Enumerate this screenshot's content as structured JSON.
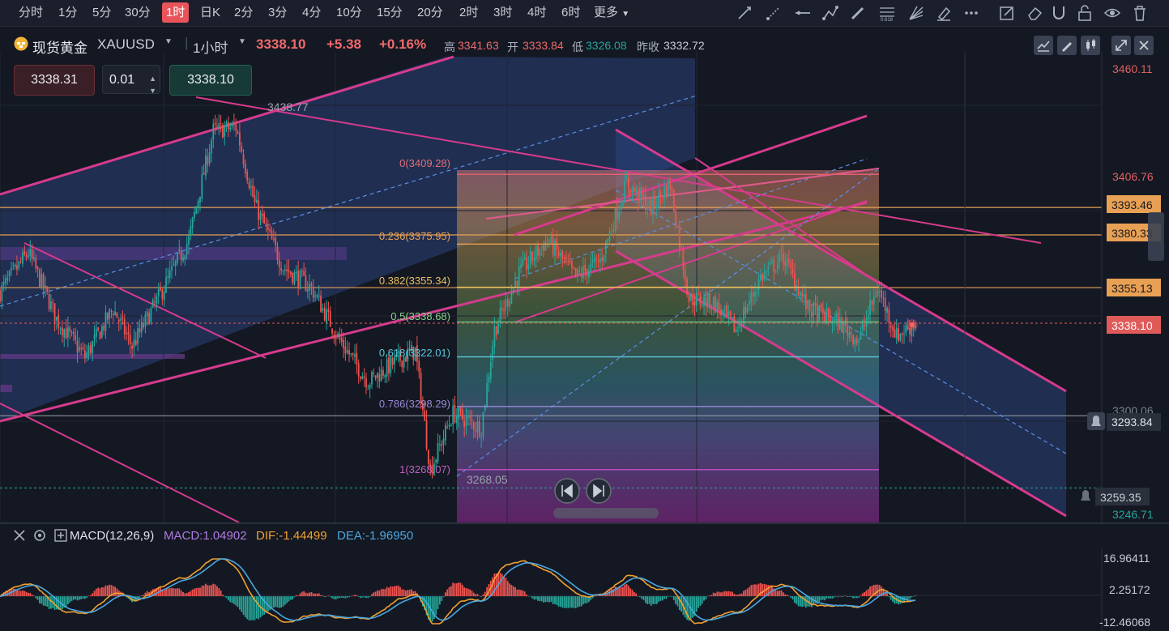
{
  "toolbar": {
    "timeframes": [
      "分时",
      "1分",
      "5分",
      "30分",
      "1时",
      "日K",
      "2分",
      "3分",
      "4分",
      "10分",
      "15分",
      "20分",
      "2时",
      "3时",
      "4时",
      "6时",
      "更多"
    ],
    "active_timeframe": "1时",
    "tools": [
      "trend-line-icon",
      "ray-line-icon",
      "horizontal-line-icon",
      "polyline-icon",
      "brush-icon",
      "fibonacci-icon",
      "fan-icon",
      "highlighter-icon",
      "more-dots-icon",
      "edit-note-icon",
      "eraser-icon",
      "magnet-icon",
      "lock-icon",
      "eye-icon",
      "trash-icon"
    ]
  },
  "symbol": {
    "name": "现货黄金",
    "code": "XAUUSD",
    "interval": "1小时",
    "price": "3338.10",
    "change": "+5.38",
    "change_pct": "+0.16%",
    "high_label": "高",
    "high": "3341.63",
    "open_label": "开",
    "open": "3333.84",
    "low_label": "低",
    "low": "3326.08",
    "prev_label": "昨收",
    "prev": "3332.72"
  },
  "order": {
    "sell_price": "3338.31",
    "lot": "0.01",
    "buy_price": "3338.10"
  },
  "colors": {
    "up": "#26a69a",
    "down": "#ef5350",
    "channel": "#d63b8d",
    "level": "#e8a055",
    "price_tag": "#e06060"
  },
  "price_axis": {
    "top": "3460.11",
    "l1": "3406.76",
    "l2": "3393.46",
    "l3": "3380.33",
    "l4": "3355.13",
    "current": "3338.10",
    "l5": "3300.06",
    "l6": "3293.84",
    "l7": "3259.35",
    "bottom": "3246.71"
  },
  "fib": {
    "f0": "0(3409.28)",
    "f236": "0.236(3375.95)",
    "f382": "0.382(3355.34)",
    "f5": "0.5(3338.68)",
    "f618": "0.618(3322.01)",
    "f786": "0.786(3298.29)",
    "f1": "1(3268.07)"
  },
  "annotations": {
    "high_mark": "3438.77",
    "low_mark": "3268.05"
  },
  "macd": {
    "label": "MACD(12,26,9)",
    "macd_value": "MACD:1.04902",
    "dif_value": "DIF:-1.44499",
    "dea_value": "DEA:-1.96950",
    "axis_top": "16.96411",
    "axis_mid": "2.25172",
    "axis_bottom": "-12.46068"
  },
  "chart_data": {
    "type": "candlestick",
    "title": "现货黄金 XAUUSD 1小时",
    "ylim": [
      3246.71,
      3460.11
    ],
    "keypoints": [
      {
        "i": 0,
        "price": 3353
      },
      {
        "i": 15,
        "price": 3372
      },
      {
        "i": 30,
        "price": 3340
      },
      {
        "i": 45,
        "price": 3322
      },
      {
        "i": 60,
        "price": 3345
      },
      {
        "i": 70,
        "price": 3327
      },
      {
        "i": 85,
        "price": 3352
      },
      {
        "i": 100,
        "price": 3378
      },
      {
        "i": 113,
        "price": 3430
      },
      {
        "i": 125,
        "price": 3432
      },
      {
        "i": 135,
        "price": 3395
      },
      {
        "i": 150,
        "price": 3365
      },
      {
        "i": 165,
        "price": 3355
      },
      {
        "i": 180,
        "price": 3330
      },
      {
        "i": 195,
        "price": 3310
      },
      {
        "i": 210,
        "price": 3320
      },
      {
        "i": 220,
        "price": 3325
      },
      {
        "i": 228,
        "price": 3268
      },
      {
        "i": 240,
        "price": 3295
      },
      {
        "i": 255,
        "price": 3288
      },
      {
        "i": 262,
        "price": 3335
      },
      {
        "i": 275,
        "price": 3362
      },
      {
        "i": 290,
        "price": 3378
      },
      {
        "i": 305,
        "price": 3360
      },
      {
        "i": 318,
        "price": 3368
      },
      {
        "i": 332,
        "price": 3405
      },
      {
        "i": 345,
        "price": 3393
      },
      {
        "i": 355,
        "price": 3405
      },
      {
        "i": 365,
        "price": 3350
      },
      {
        "i": 378,
        "price": 3348
      },
      {
        "i": 390,
        "price": 3335
      },
      {
        "i": 403,
        "price": 3360
      },
      {
        "i": 415,
        "price": 3370
      },
      {
        "i": 428,
        "price": 3345
      },
      {
        "i": 445,
        "price": 3338
      },
      {
        "i": 455,
        "price": 3330
      },
      {
        "i": 465,
        "price": 3355
      },
      {
        "i": 475,
        "price": 3332
      },
      {
        "i": 485,
        "price": 3338
      }
    ],
    "candle_count": 486,
    "fib_levels": [
      {
        "ratio": 0,
        "price": 3409.28
      },
      {
        "ratio": 0.236,
        "price": 3375.95
      },
      {
        "ratio": 0.382,
        "price": 3355.34
      },
      {
        "ratio": 0.5,
        "price": 3338.68
      },
      {
        "ratio": 0.618,
        "price": 3322.01
      },
      {
        "ratio": 0.786,
        "price": 3298.29
      },
      {
        "ratio": 1,
        "price": 3268.07
      }
    ],
    "horizontal_levels": [
      3393.46,
      3380.33,
      3355.13,
      3293.84,
      3259.35
    ],
    "macd": {
      "ylim": [
        -12.46068,
        16.96411
      ]
    }
  }
}
